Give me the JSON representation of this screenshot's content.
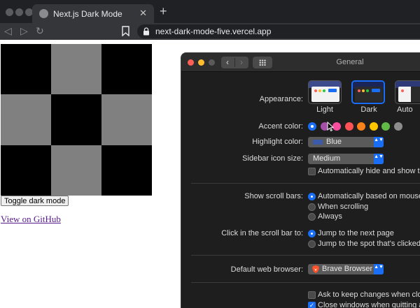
{
  "browser": {
    "tab_title": "Next.js Dark Mode",
    "tab_close": "✕",
    "new_tab": "+",
    "back": "◁",
    "forward": "▷",
    "reload": "↻",
    "url": "next-dark-mode-five.vercel.app"
  },
  "page": {
    "checkerboard": [
      "black",
      "gray",
      "black",
      "gray",
      "black",
      "gray",
      "black",
      "gray",
      "black"
    ],
    "toggle_button": "Toggle dark mode",
    "github_link": "View on GitHub"
  },
  "prefs": {
    "title": "General",
    "back": "‹",
    "forward": "›",
    "appearance_label": "Appearance:",
    "appearance_options": [
      "Light",
      "Dark",
      "Auto"
    ],
    "appearance_selected": "Dark",
    "accent_label": "Accent color:",
    "accent_colors": [
      "#1a6ef5",
      "#a550a7",
      "#f74f9e",
      "#ff5257",
      "#f7821b",
      "#ffc600",
      "#62ba46",
      "#8c8c8c"
    ],
    "accent_selected": "#1a6ef5",
    "highlight_label": "Highlight color:",
    "highlight_value": "Blue",
    "sidebar_label": "Sidebar icon size:",
    "sidebar_value": "Medium",
    "auto_hide_menu": "Automatically hide and show the m",
    "scroll_label": "Show scroll bars:",
    "scroll_options": [
      "Automatically based on mouse or",
      "When scrolling",
      "Always"
    ],
    "scroll_selected": 0,
    "click_label": "Click in the scroll bar to:",
    "click_options": [
      "Jump to the next page",
      "Jump to the spot that's clicked"
    ],
    "click_selected": 0,
    "browser_label": "Default web browser:",
    "browser_value": "Brave Browser",
    "ask_keep_changes": "Ask to keep changes when closing",
    "close_windows": "Close windows when quitting an a",
    "popup_arrows": "▲▼",
    "check_mark": "✓"
  },
  "colors": {
    "accent": "#1a6ef5",
    "link": "#551a8b"
  }
}
